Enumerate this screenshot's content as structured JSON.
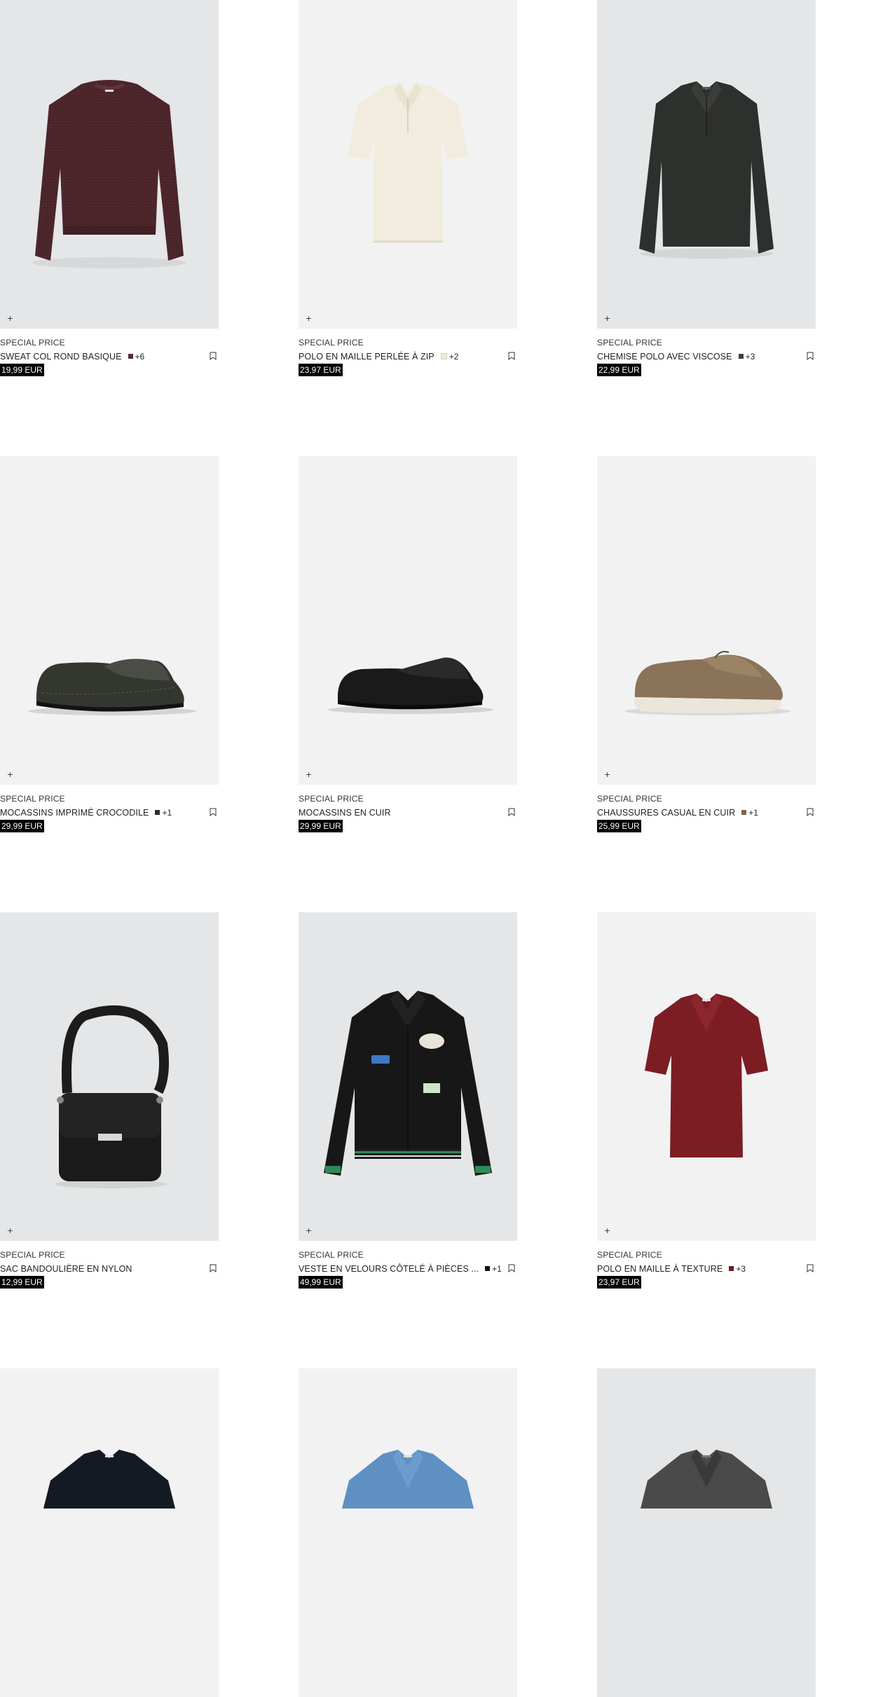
{
  "colors": {
    "price_bg": "#000000",
    "price_fg": "#ffffff",
    "tile_grey": "#e4e6e7",
    "tile_light": "#f2f2f2"
  },
  "products": [
    {
      "tag": "SPECIAL PRICE",
      "name": "SWEAT COL ROND BASIQUE",
      "swatch": "#5a2b30",
      "more": "+6",
      "price": "19,99 EUR",
      "bg": "#e4e6e7",
      "item": "sweatshirt"
    },
    {
      "tag": "SPECIAL PRICE",
      "name": "POLO EN MAILLE PERLÉE À ZIP",
      "swatch": "#efe9da",
      "more": "+2",
      "price": "23,97 EUR",
      "bg": "#f2f2f2",
      "item": "polo-cream"
    },
    {
      "tag": "SPECIAL PRICE",
      "name": "CHEMISE POLO AVEC VISCOSE",
      "swatch": "#3d3f3b",
      "more": "+3",
      "price": "22,99 EUR",
      "bg": "#e4e6e7",
      "item": "shirt-dark"
    },
    {
      "tag": "SPECIAL PRICE",
      "name": "MOCASSINS IMPRIMÉ CROCODILE",
      "swatch": "#2e2f2c",
      "more": "+1",
      "price": "29,99 EUR",
      "bg": "#f2f2f2",
      "item": "loafer-croc"
    },
    {
      "tag": "SPECIAL PRICE",
      "name": "MOCASSINS EN CUIR",
      "swatch": "",
      "more": "",
      "price": "29,99 EUR",
      "bg": "#f2f2f2",
      "item": "loafer-black"
    },
    {
      "tag": "SPECIAL PRICE",
      "name": "CHAUSSURES CASUAL EN CUIR",
      "swatch": "#7b6750",
      "more": "+1",
      "price": "25,99 EUR",
      "bg": "#f2f2f2",
      "item": "casual-shoe"
    },
    {
      "tag": "SPECIAL PRICE",
      "name": "SAC BANDOULIÈRE EN NYLON",
      "swatch": "",
      "more": "",
      "price": "12,99 EUR",
      "bg": "#e4e6e7",
      "item": "bag"
    },
    {
      "tag": "SPECIAL PRICE",
      "name": "VESTE EN VELOURS CÔTELÉ À PIÈCES ...",
      "swatch": "#111111",
      "more": "+1",
      "price": "49,99 EUR",
      "bg": "#e4e6e7",
      "item": "jacket"
    },
    {
      "tag": "SPECIAL PRICE",
      "name": "POLO EN MAILLE À TEXTURE",
      "swatch": "#6e1c22",
      "more": "+3",
      "price": "23,97 EUR",
      "bg": "#f2f2f2",
      "item": "polo-red"
    },
    {
      "tag": "",
      "name": "",
      "swatch": "",
      "more": "",
      "price": "",
      "bg": "#f2f2f2",
      "item": "polo-navy"
    },
    {
      "tag": "",
      "name": "",
      "swatch": "",
      "more": "",
      "price": "",
      "bg": "#f2f2f2",
      "item": "polo-blue"
    },
    {
      "tag": "",
      "name": "",
      "swatch": "",
      "more": "",
      "price": "",
      "bg": "#e4e6e7",
      "item": "shirt-grey"
    }
  ],
  "icons": {
    "quick_add": "+",
    "wishlist": "bookmark-icon"
  }
}
